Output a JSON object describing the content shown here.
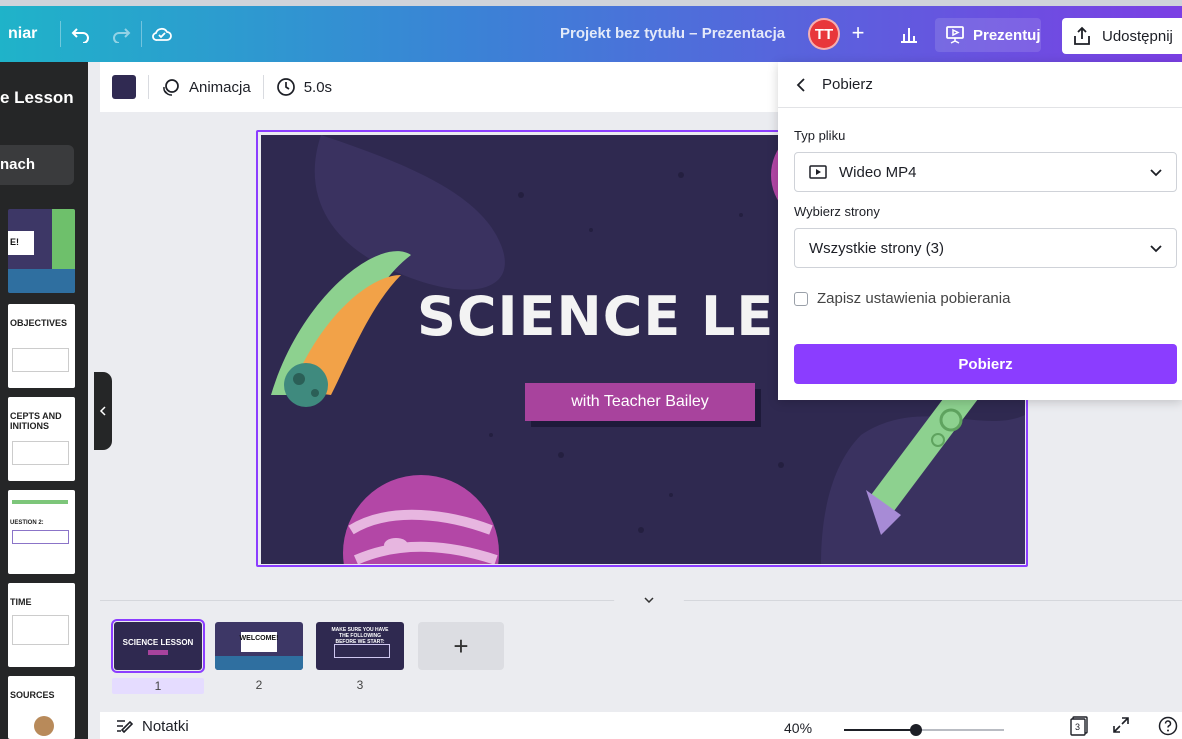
{
  "topbar": {
    "home_label": "niar",
    "undo_icon": "undo-icon",
    "redo_icon": "redo-icon",
    "cloud_icon": "cloud-check-icon",
    "title": "Projekt bez tytułu – Prezentacja",
    "avatar_initials": "TT",
    "add_label": "+",
    "present_label": "Prezentuj",
    "share_label": "Udostępnij"
  },
  "sidebar": {
    "title": "e Lesson",
    "button_label": "nach",
    "thumbs": [
      {
        "title": "E!"
      },
      {
        "title": "OBJECTIVES"
      },
      {
        "title": "CEPTS AND\nINITIONS"
      },
      {
        "title": "UESTION 2:"
      },
      {
        "title": "TIME"
      },
      {
        "title": "SOURCES"
      }
    ]
  },
  "editbar": {
    "color": "#302a52",
    "animation_label": "Animacja",
    "duration_label": "5.0s"
  },
  "slide": {
    "title": "SCIENCE LESS",
    "subtitle": "with Teacher Bailey"
  },
  "download_panel": {
    "back_label": "Pobierz",
    "file_type_label": "Typ pliku",
    "file_type_value": "Wideo MP4",
    "pages_label": "Wybierz strony",
    "pages_value": "Wszystkie strony (3)",
    "save_settings_label": "Zapisz ustawienia pobierania",
    "save_settings_checked": false,
    "download_button": "Pobierz"
  },
  "filmstrip": {
    "pages": [
      {
        "number": "1",
        "caption": "SCIENCE LESSON",
        "selected": true
      },
      {
        "number": "2",
        "caption": "WELCOME!",
        "selected": false
      },
      {
        "number": "3",
        "caption": "MAKE SURE YOU HAVE THE FOLLOWING BEFORE WE START:",
        "selected": false
      }
    ],
    "add_page_label": "+"
  },
  "bottombar": {
    "notes_label": "Notatki",
    "zoom_label": "40%",
    "zoom_fraction": 0.45,
    "page_count": "3"
  },
  "colors": {
    "accent": "#8b3dff",
    "slide_bg": "#2f2950",
    "subtitle_bg": "#a8439d"
  }
}
